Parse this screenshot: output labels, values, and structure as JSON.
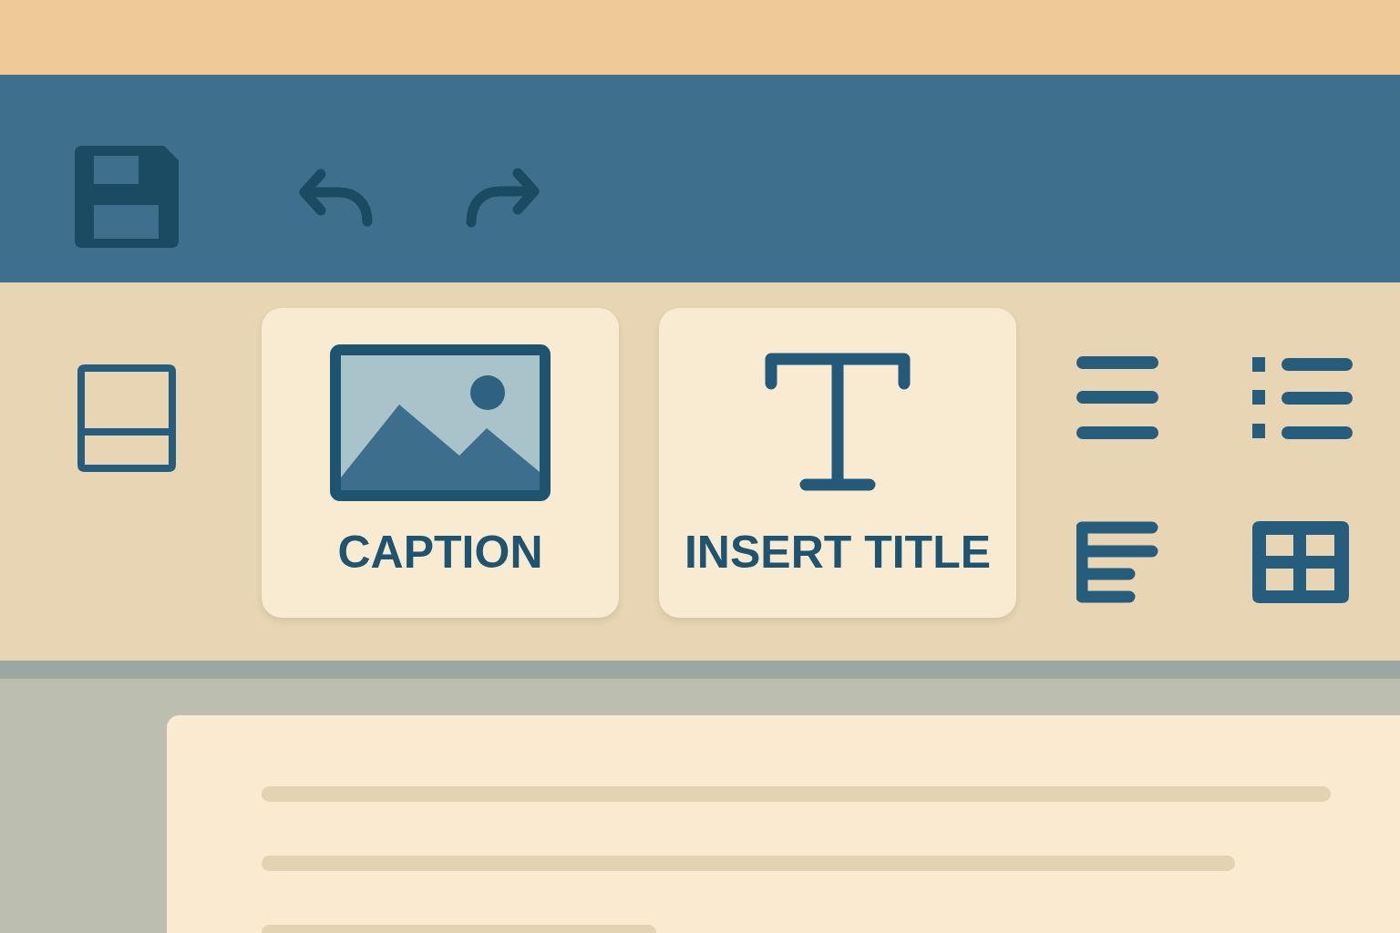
{
  "ribbon": {
    "large_buttons": [
      {
        "kind": "image",
        "label": "CAPTION"
      },
      {
        "kind": "text",
        "label": "INSERT TITLE"
      }
    ]
  }
}
